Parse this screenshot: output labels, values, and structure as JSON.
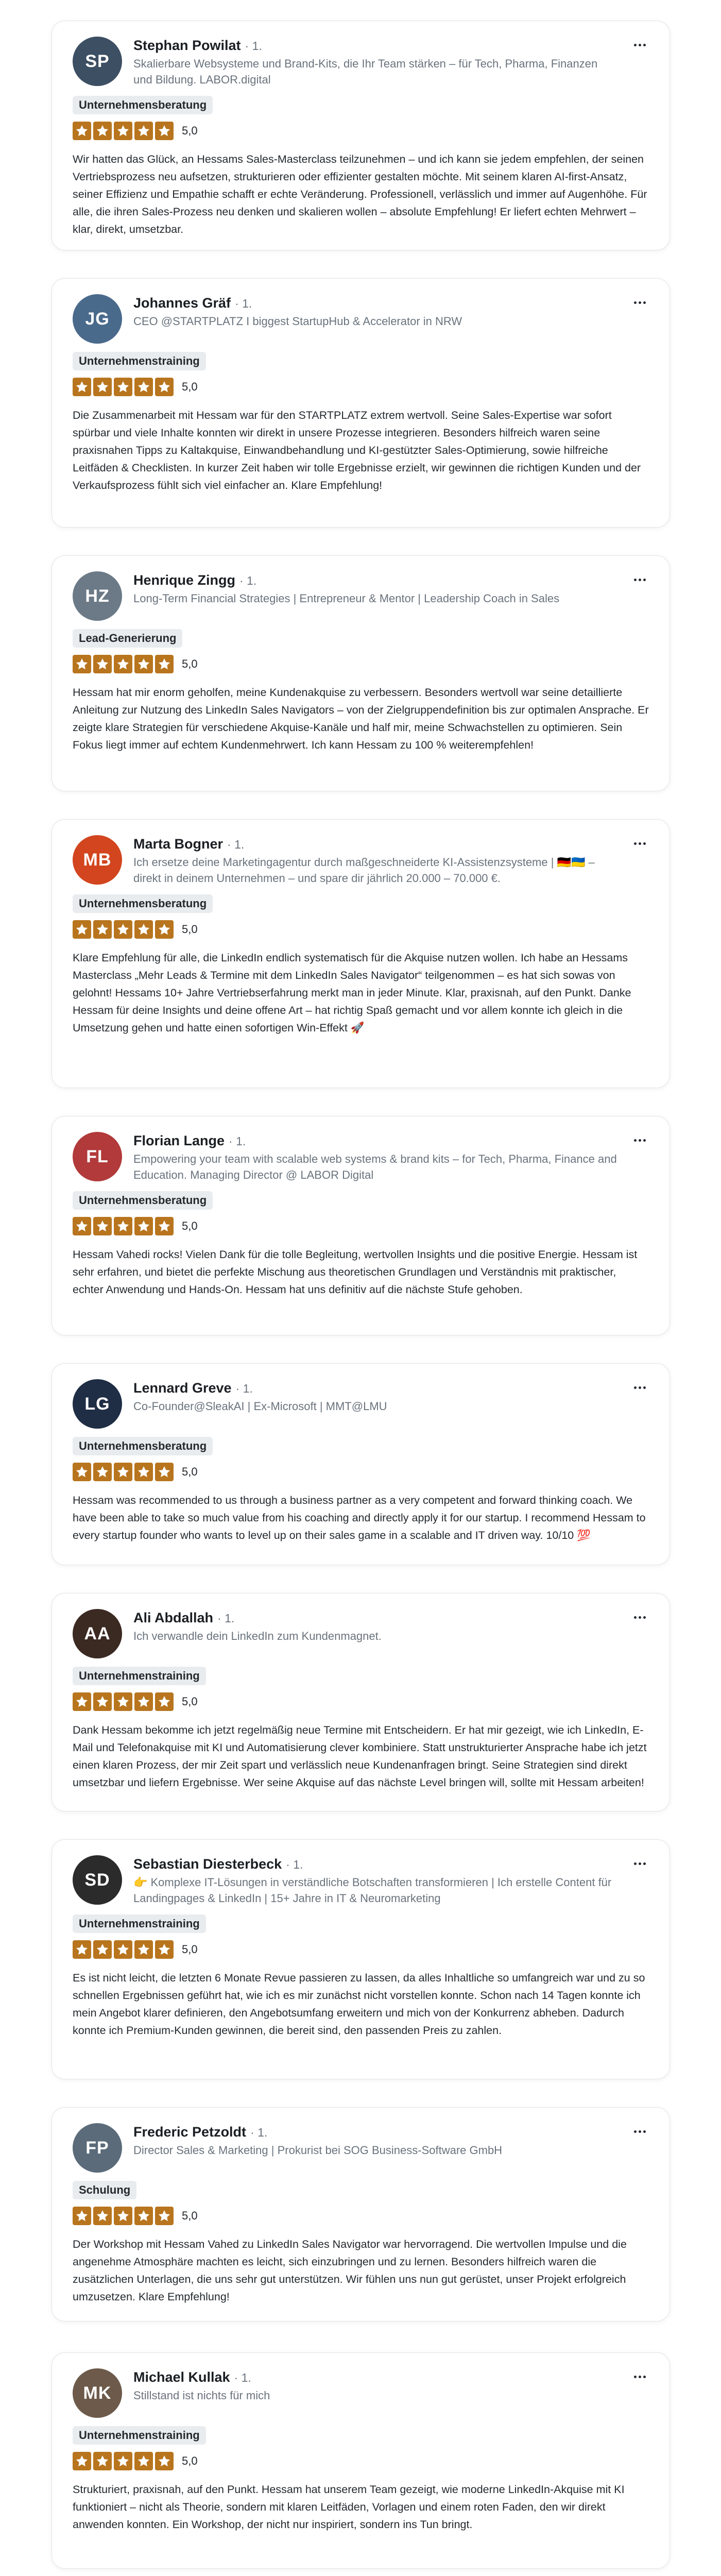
{
  "rating_label": "5,0",
  "more_label": "Weitere Optionen",
  "reviews": [
    {
      "name": "Stephan Powilat",
      "degree": "· 1.",
      "headline": "Skalierbare Websysteme und Brand-Kits, die Ihr Team stärken – für Tech, Pharma, Finanzen und Bildung. LABOR.digital",
      "tag": "Unternehmensberatung",
      "rating": 5,
      "text": "Wir hatten das Glück, an Hessams Sales-Masterclass teilzunehmen – und ich kann sie jedem empfehlen, der seinen Vertriebsprozess neu aufsetzen, strukturieren oder effizienter gestalten möchte. Mit seinem klaren AI-first-Ansatz, seiner Effizienz und Empathie schafft er echte Veränderung. Professionell, verlässlich und immer auf Augenhöhe. Für alle, die ihren Sales-Prozess neu denken und skalieren wollen – absolute Empfehlung! Er liefert echten Mehrwert – klar, direkt, umsetzbar.",
      "initials": "SP",
      "avatar_color": "#3d4f63"
    },
    {
      "name": "Johannes Gräf",
      "degree": "· 1.",
      "headline": "CEO @STARTPLATZ I biggest StartupHub & Accelerator in NRW",
      "tag": "Unternehmenstraining",
      "rating": 5,
      "text": "Die Zusammenarbeit mit Hessam war für den STARTPLATZ extrem wertvoll. Seine Sales-Expertise war sofort spürbar und viele Inhalte konnten wir direkt in unsere Prozesse integrieren. Besonders hilfreich waren seine praxisnahen Tipps zu Kaltakquise, Einwandbehandlung und KI-gestützter Sales-Optimierung, sowie hilfreiche Leitfäden & Checklisten. In kurzer Zeit haben wir tolle Ergebnisse erzielt, wir gewinnen die richtigen Kunden und der Verkaufsprozess fühlt sich viel einfacher an. Klare Empfehlung!",
      "initials": "JG",
      "avatar_color": "#4a6a8c"
    },
    {
      "name": "Henrique Zingg",
      "degree": "· 1.",
      "headline": "Long-Term Financial Strategies | Entrepreneur & Mentor | Leadership Coach in Sales",
      "tag": "Lead-Generierung",
      "rating": 5,
      "text": "Hessam hat mir enorm geholfen, meine Kundenakquise zu verbessern. Besonders wertvoll war seine detaillierte Anleitung zur Nutzung des LinkedIn Sales Navigators – von der Zielgruppendefinition bis zur optimalen Ansprache. Er zeigte klare Strategien für verschiedene Akquise-Kanäle und half mir, meine Schwachstellen zu optimieren. Sein Fokus liegt immer auf echtem Kundenmehrwert. Ich kann Hessam zu 100 % weiterempfehlen!",
      "initials": "HZ",
      "avatar_color": "#6b7a86"
    },
    {
      "name": "Marta Bogner",
      "degree": "· 1.",
      "headline": "Ich ersetze deine Marketingagentur durch maßgeschneiderte KI-Assistenzsysteme | 🇩🇪🇺🇦 – direkt in deinem Unternehmen – und spare dir jährlich 20.000 – 70.000 €.",
      "tag": "Unternehmensberatung",
      "rating": 5,
      "text": "Klare Empfehlung für alle, die LinkedIn endlich systematisch für die Akquise nutzen wollen. Ich habe an Hessams Masterclass „Mehr Leads & Termine mit dem LinkedIn Sales Navigator“ teilgenommen – es hat sich sowas von gelohnt! Hessams 10+ Jahre Vertriebserfahrung merkt man in jeder Minute. Klar, praxisnah, auf den Punkt. Danke Hessam für deine Insights und deine offene Art – hat richtig Spaß gemacht und vor allem konnte ich gleich in die Umsetzung gehen und hatte einen sofortigen Win-Effekt 🚀",
      "initials": "MB",
      "avatar_color": "#d2451e"
    },
    {
      "name": "Florian Lange",
      "degree": "· 1.",
      "headline": "Empowering your team with scalable web systems & brand kits – for Tech, Pharma, Finance and Education. Managing Director @ LABOR Digital",
      "tag": "Unternehmensberatung",
      "rating": 5,
      "text": "Hessam Vahedi rocks! Vielen Dank für die tolle Begleitung, wertvollen Insights und die positive Energie. Hessam ist sehr erfahren, und bietet die perfekte Mischung aus theoretischen Grundlagen und Verständnis mit praktischer, echter Anwendung und Hands-On. Hessam hat uns definitiv auf die nächste Stufe gehoben.",
      "initials": "FL",
      "avatar_color": "#b23a3a"
    },
    {
      "name": "Lennard Greve",
      "degree": "· 1.",
      "headline": "Co-Founder@SleakAI | Ex-Microsoft | MMT@LMU",
      "tag": "Unternehmensberatung",
      "rating": 5,
      "text": "Hessam was recommended to us through a business partner as a very competent and forward thinking coach. We have been able to take so much value from his coaching and directly apply it for our startup. I recommend Hessam to every startup founder who wants to level up on their sales game in a scalable and IT driven way. 10/10 💯",
      "initials": "LG",
      "avatar_color": "#1f2d45"
    },
    {
      "name": "Ali Abdallah",
      "degree": "· 1.",
      "headline": "Ich verwandle dein LinkedIn zum Kundenmagnet.",
      "tag": "Unternehmenstraining",
      "rating": 5,
      "text": "Dank Hessam bekomme ich jetzt regelmäßig neue Termine mit Entscheidern. Er hat mir gezeigt, wie ich LinkedIn, E-Mail und Telefonakquise mit KI und Automatisierung clever kombiniere. Statt unstrukturierter Ansprache habe ich jetzt einen klaren Prozess, der mir Zeit spart und verlässlich neue Kundenanfragen bringt. Seine Strategien sind direkt umsetzbar und liefern Ergebnisse. Wer seine Akquise auf das nächste Level bringen will, sollte mit Hessam arbeiten!",
      "initials": "AA",
      "avatar_color": "#3b2a22"
    },
    {
      "name": "Sebastian Diesterbeck",
      "degree": "· 1.",
      "headline": "👉 Komplexe IT-Lösungen in verständliche Botschaften transformieren | Ich erstelle Content für Landingpages & LinkedIn | 15+ Jahre in IT & Neuromarketing",
      "tag": "Unternehmenstraining",
      "rating": 5,
      "text": "Es ist nicht leicht, die letzten 6 Monate Revue passieren zu lassen, da alles Inhaltliche so umfangreich war und zu so schnellen Ergebnissen geführt hat, wie ich es mir zunächst nicht vorstellen konnte. Schon nach 14 Tagen konnte ich mein Angebot klarer definieren, den Angebotsumfang erweitern und mich von der Konkurrenz abheben. Dadurch konnte ich Premium-Kunden gewinnen, die bereit sind, den passenden Preis zu zahlen.",
      "initials": "SD",
      "avatar_color": "#2b2b2b"
    },
    {
      "name": "Frederic Petzoldt",
      "degree": "· 1.",
      "headline": "Director Sales & Marketing | Prokurist bei SOG Business-Software GmbH",
      "tag": "Schulung",
      "rating": 5,
      "text": "Der Workshop mit Hessam Vahed zu LinkedIn Sales Navigator war hervorragend. Die wertvollen Impulse und die angenehme Atmosphäre machten es leicht, sich einzubringen und zu lernen. Besonders hilfreich waren die zusätzlichen Unterlagen, die uns sehr gut unterstützen. Wir fühlen uns nun gut gerüstet, unser Projekt erfolgreich umzusetzen. Klare Empfehlung!",
      "initials": "FP",
      "avatar_color": "#5b6b7a"
    },
    {
      "name": "Michael Kullak",
      "degree": "· 1.",
      "headline": "Stillstand ist nichts für mich",
      "tag": "Unternehmenstraining",
      "rating": 5,
      "text": "Strukturiert, praxisnah, auf den Punkt. Hessam hat unserem Team gezeigt, wie moderne LinkedIn-Akquise mit KI funktioniert – nicht als Theorie, sondern mit klaren Leitfäden, Vorlagen und einem roten Faden, den wir direkt anwenden konnten. Ein Workshop, der nicht nur inspiriert, sondern ins Tun bringt.",
      "initials": "MK",
      "avatar_color": "#6d5a4a"
    }
  ]
}
